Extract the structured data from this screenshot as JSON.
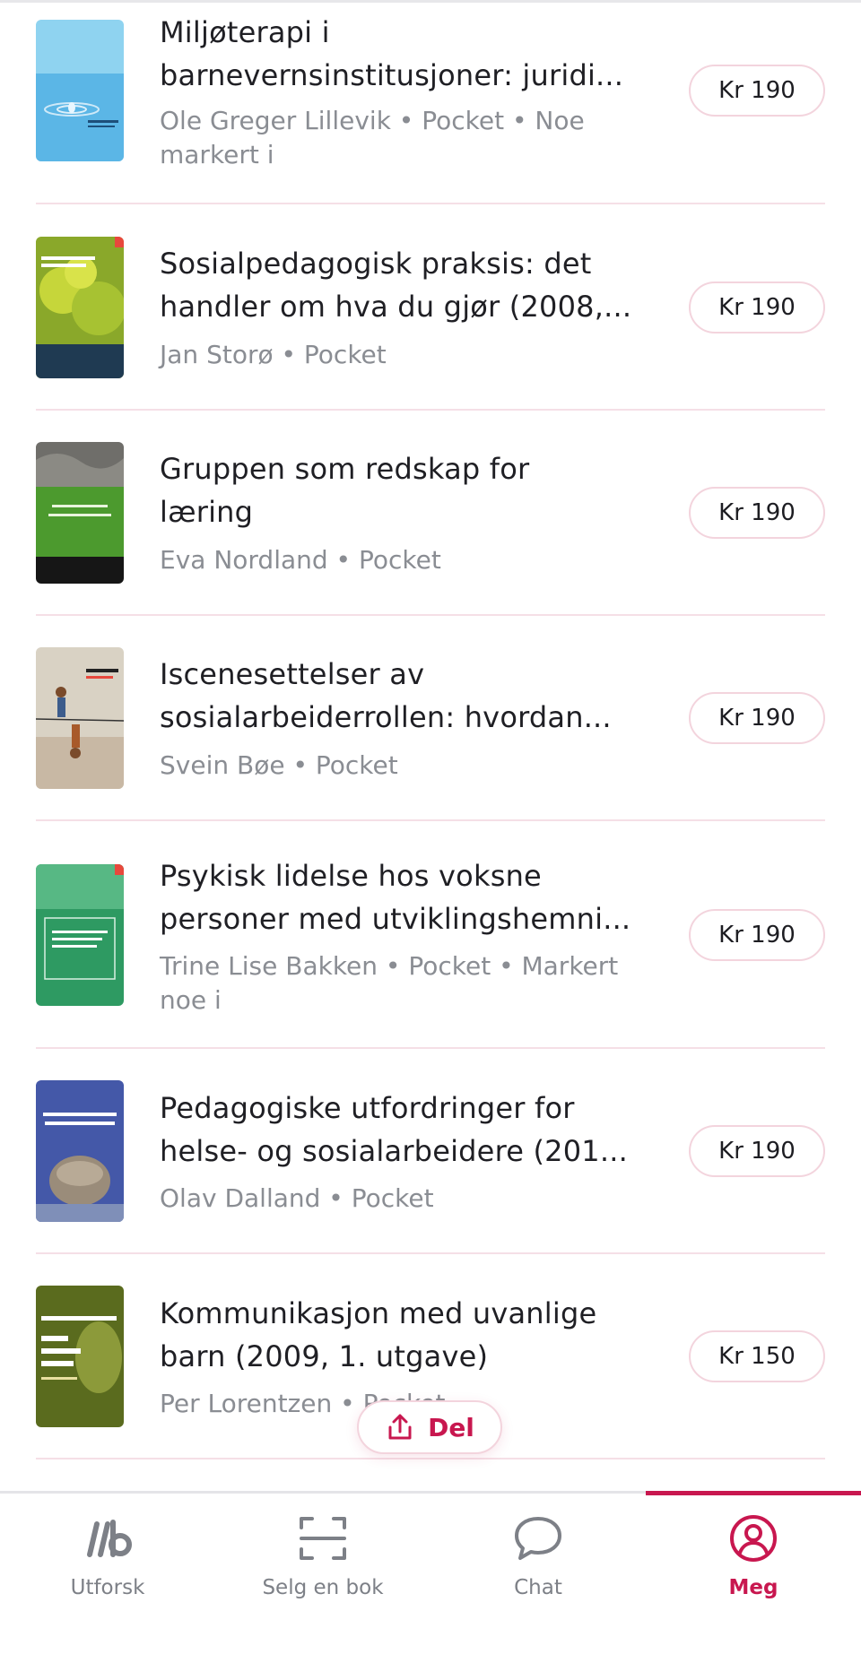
{
  "books": [
    {
      "title_line1": "Miljøterapi i",
      "title_line2": "barnevernsinstitusjoner: juridi...",
      "meta_line1": "Ole Greger Lillevik • Pocket • Noe",
      "meta_line2": "markert i",
      "price": "Kr 190"
    },
    {
      "title_line1": "Sosialpedagogisk praksis: det",
      "title_line2": "handler om hva du gjør (2008,...",
      "meta_line1": "Jan Storø • Pocket",
      "meta_line2": "",
      "price": "Kr 190"
    },
    {
      "title_line1": "Gruppen som redskap for",
      "title_line2": "læring",
      "meta_line1": "Eva Nordland • Pocket",
      "meta_line2": "",
      "price": "Kr 190"
    },
    {
      "title_line1": "Iscenesettelser av",
      "title_line2": "sosialarbeiderrollen: hvordan...",
      "meta_line1": "Svein Bøe • Pocket",
      "meta_line2": "",
      "price": "Kr 190"
    },
    {
      "title_line1": "Psykisk lidelse hos voksne",
      "title_line2": "personer med utviklingshemni...",
      "meta_line1": "Trine Lise Bakken • Pocket • Markert",
      "meta_line2": "noe i",
      "price": "Kr 190"
    },
    {
      "title_line1": "Pedagogiske utfordringer for",
      "title_line2": "helse- og sosialarbeidere (201...",
      "meta_line1": "Olav Dalland • Pocket",
      "meta_line2": "",
      "price": "Kr 190"
    },
    {
      "title_line1": "Kommunikasjon med uvanlige",
      "title_line2": "barn (2009, 1. utgave)",
      "meta_line1": "Per Lorentzen • Pocket",
      "meta_line2": "",
      "price": "Kr 150"
    }
  ],
  "share": {
    "label": "Del",
    "icon": "share-icon"
  },
  "tabs": [
    {
      "label": "Utforsk",
      "icon": "logo-icon",
      "active": false
    },
    {
      "label": "Selg en bok",
      "icon": "scan-icon",
      "active": false
    },
    {
      "label": "Chat",
      "icon": "chat-bubble-icon",
      "active": false
    },
    {
      "label": "Meg",
      "icon": "user-circle-icon",
      "active": true
    }
  ],
  "colors": {
    "accent": "#c8174f",
    "divider": "#f5dfe6",
    "muted": "#8a8d93"
  }
}
